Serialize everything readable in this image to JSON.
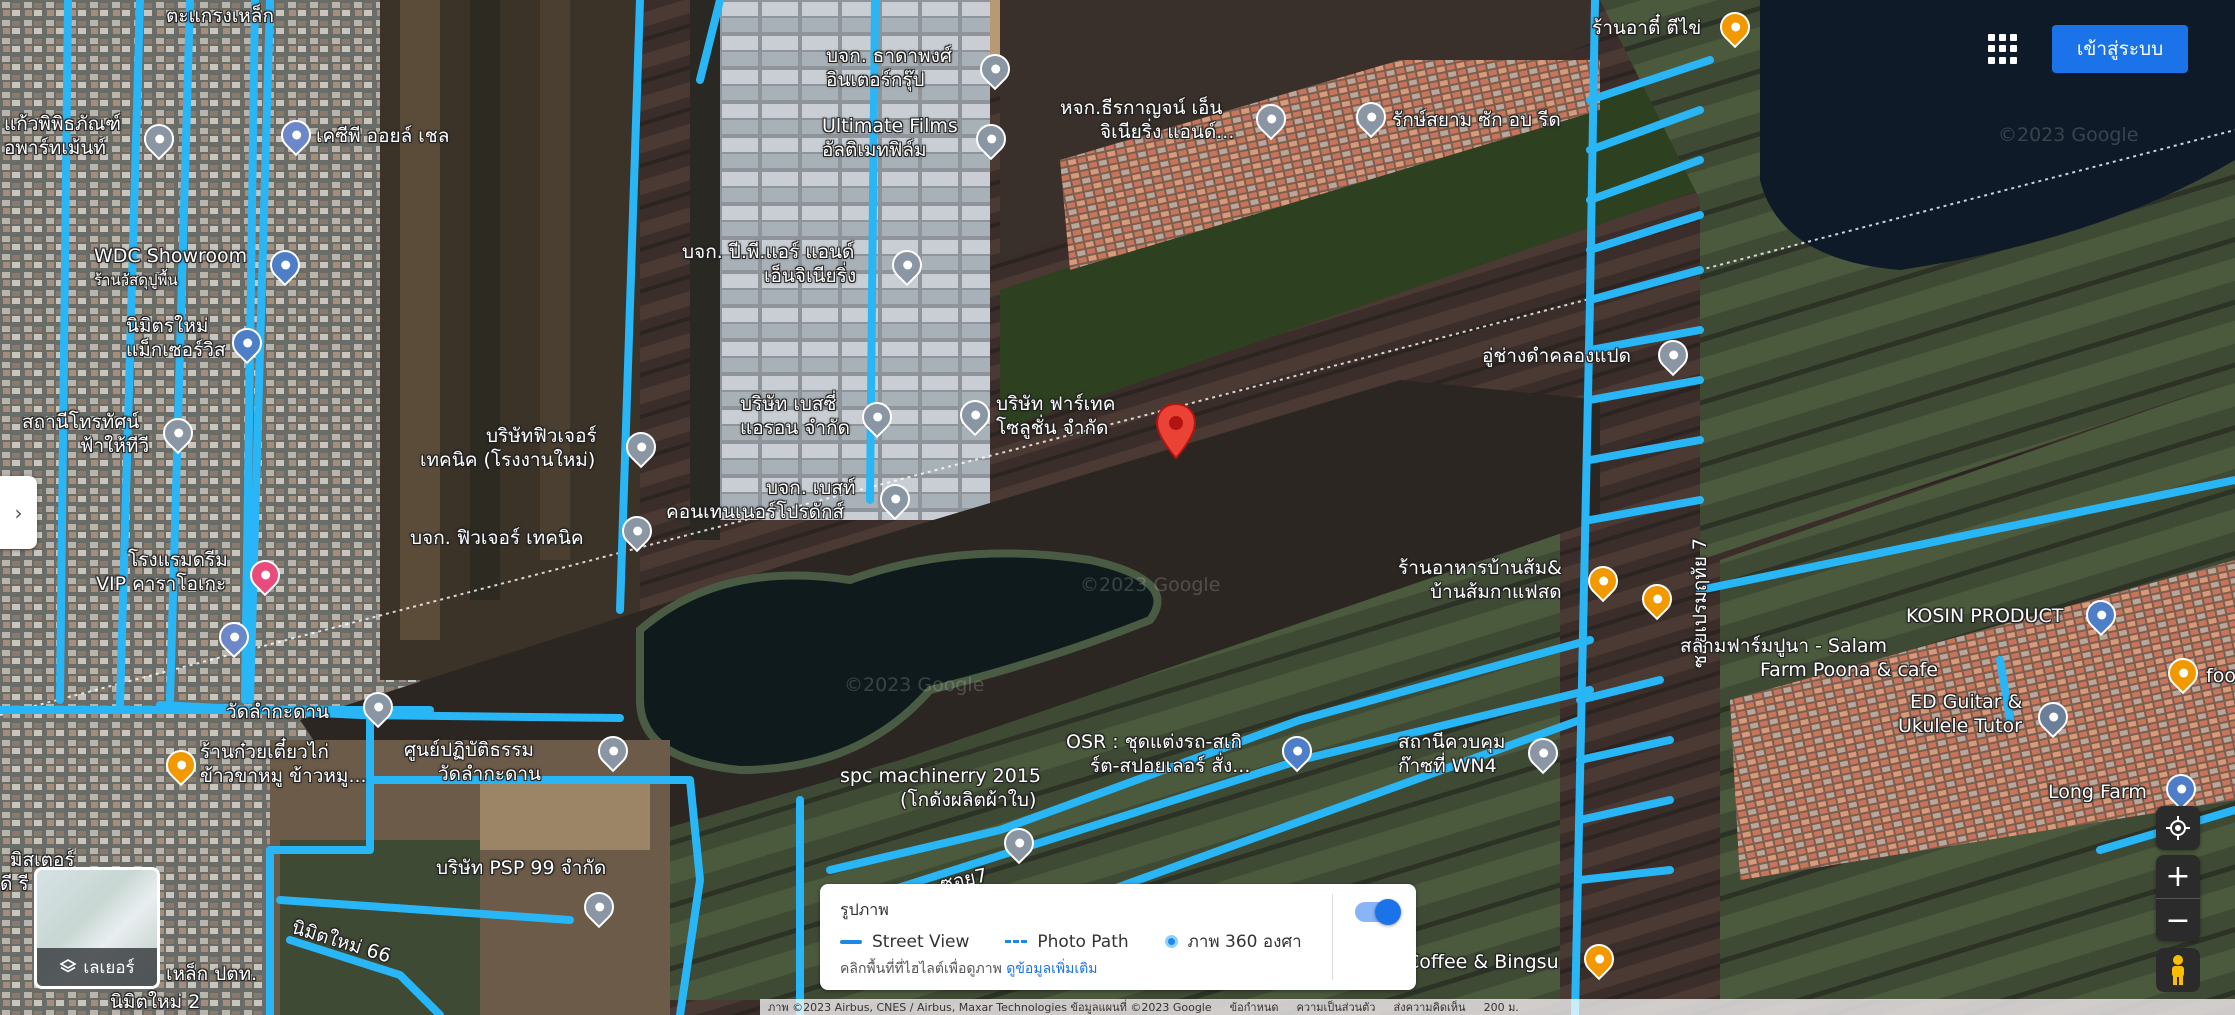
{
  "colors": {
    "road_blue": "#29b6f6",
    "accent_blue": "#1a73e8",
    "marker_red": "#ea4335"
  },
  "header": {
    "apps_icon": "apps-grid-icon",
    "signin_label": "เข้าสู่ระบบ"
  },
  "places": [
    {
      "name": "ตะแกรงเหล็ก",
      "lines": [
        "ตะแกรงเหล็ก"
      ],
      "kind": "gray"
    },
    {
      "name": "แก้วพิพิธภัณฑ์ อพาร์ทเม้นท์",
      "lines": [
        "แก้วพิพิธภัณฑ์",
        "อพาร์ทเม้นท์"
      ],
      "kind": "gray"
    },
    {
      "name": "เคซีพี ออยล์ เชล",
      "lines": [
        "เคซีพี ออยล์ เชล"
      ],
      "kind": "fuel"
    },
    {
      "name": "WDC Showroom",
      "lines": [
        "WDC Showroom",
        "ร้านวัสดุปูพื้น"
      ],
      "kind": "shop"
    },
    {
      "name": "นิมิตรใหม่ แม็กเซอร์วิส",
      "lines": [
        "นิมิตรใหม่",
        "แม็กเซอร์วิส"
      ],
      "kind": "shop"
    },
    {
      "name": "สถานีโทรทัศน์ ฟ้าให้ทีวี",
      "lines": [
        "สถานีโทรทัศน์",
        "ฟ้าให้ทีวี"
      ],
      "kind": "gray"
    },
    {
      "name": "โรงแรมดรีม VIP คาราโอเกะ",
      "lines": [
        "โรงแรมดรีม",
        "VIP คาราโอเกะ"
      ],
      "kind": "red"
    },
    {
      "name": "วัดลำกะดาน",
      "lines": [
        "วัดลำกะดาน"
      ],
      "kind": "gray"
    },
    {
      "name": "ร้านก๋วยเตี๋ยวไก่ ข้าวขาหมู ข้าวหมู...",
      "lines": [
        "ร้านก๋วยเตี๋ยวไก่",
        "ข้าวขาหมู ข้าวหมู..."
      ],
      "kind": "food"
    },
    {
      "name": "มิสเตอร์",
      "lines": [
        "มิสเตอร์"
      ],
      "kind": "shop"
    },
    {
      "name": "บจก. ธาดาพงศ์ อินเตอร์กรุ๊ป",
      "lines": [
        "บจก. ธาดาพงศ์",
        "อินเตอร์กรุ๊ป"
      ],
      "kind": "gray"
    },
    {
      "name": "Ultimate Films อัลติเมทฟิล์ม",
      "lines": [
        "Ultimate Films",
        "อัลติเมทฟิล์ม"
      ],
      "kind": "gray"
    },
    {
      "name": "บจก. ปี.พี.แอร์ แอนด์ เอ็นจิเนียริ่ง",
      "lines": [
        "บจก. ปี.พี.แอร์ แอนด์",
        "เอ็นจิเนียริ่ง"
      ],
      "kind": "gray"
    },
    {
      "name": "บริษัท เบสซี่ แอรอน จำกัด",
      "lines": [
        "บริษัท เบสซี่",
        "แอรอน จำกัด"
      ],
      "kind": "gray"
    },
    {
      "name": "บริษัท ฟาร์เทค โซลูชั่น จำกัด",
      "lines": [
        "บริษัท ฟาร์เทค",
        "โซลูชั่น จำกัด"
      ],
      "kind": "gray"
    },
    {
      "name": "บริษัทฟิวเจอร์ เทคนิค (โรงงานใหม่)",
      "lines": [
        "บริษัทฟิวเจอร์",
        "เทคนิค (โรงงานใหม่)"
      ],
      "kind": "gray"
    },
    {
      "name": "บจก. เบสท์ คอนเทนเนอร์โปรดักส์",
      "lines": [
        "บจก. เบสท์",
        "คอนเทนเนอร์โปรดักส์"
      ],
      "kind": "gray"
    },
    {
      "name": "บจก. ฟิวเจอร์ เทคนิค",
      "lines": [
        "บจก. ฟิวเจอร์ เทคนิค"
      ],
      "kind": "gray"
    },
    {
      "name": "ศูนย์ปฏิบัติธรรม วัดลำกะดาน",
      "lines": [
        "ศูนย์ปฏิบัติธรรม",
        "วัดลำกะดาน"
      ],
      "kind": "gray"
    },
    {
      "name": "บริษัท PSP 99 จำกัด",
      "lines": [
        "บริษัท PSP 99 จำกัด"
      ],
      "kind": "gray"
    },
    {
      "name": "spc machinerry 2015 (โกดังผลิตผ้าใบ)",
      "lines": [
        "spc machinerry 2015",
        "(โกดังผลิตผ้าใบ)"
      ],
      "kind": "gray"
    },
    {
      "name": "OSR : ชุดแต่งรถ-สเกิร์ต-สปอยเลอร์ สั่ง...",
      "lines": [
        "OSR : ชุดแต่งรถ-สเกิ",
        "ร์ต-สปอยเลอร์ สั่ง..."
      ],
      "kind": "shop"
    },
    {
      "name": "หจก.ธีรกาญจน์ เอ็น จิเนียริ่ง แอนด์...",
      "lines": [
        "หจก.ธีรกาญจน์ เอ็น",
        "จิเนียริ่ง แอนด์..."
      ],
      "kind": "gray"
    },
    {
      "name": "รักษ์สยาม ซัก อบ รีด",
      "lines": [
        "รักษ์สยาม ซัก อบ รีด"
      ],
      "kind": "gray"
    },
    {
      "name": "ร้านอาตี๋ ตีไข่",
      "lines": [
        "ร้านอาตี๋ ตีไข่"
      ],
      "kind": "food"
    },
    {
      "name": "อู่ช่างดำคลองแปด",
      "lines": [
        "อู่ช่างดำคลองแปด"
      ],
      "kind": "gray"
    },
    {
      "name": "ร้านอาหารบ้านส้ม& บ้านส้มกาแฟสด",
      "lines": [
        "ร้านอาหารบ้านส้ม&",
        "บ้านส้มกาแฟสด"
      ],
      "kind": "food"
    },
    {
      "name": "สถานีควบคุม ก๊าซที่ WN4",
      "lines": [
        "สถานีควบคุม",
        "ก๊าซที่ WN4"
      ],
      "kind": "gray"
    },
    {
      "name": "สลามฟาร์มปูนา - Salam Farm Poona & cafe",
      "lines": [
        "สลามฟาร์มปูนา - Salam",
        "Farm Poona & cafe"
      ],
      "kind": "food"
    },
    {
      "name": "KOSIN PRODUCT",
      "lines": [
        "KOSIN PRODUCT"
      ],
      "kind": "shop"
    },
    {
      "name": "ED Guitar & Ukulele Tutor",
      "lines": [
        "ED Guitar &",
        "Ukulele Tutor"
      ],
      "kind": "edu"
    },
    {
      "name": "Long Farm",
      "lines": [
        "Long Farm"
      ],
      "kind": "shop"
    },
    {
      "name": "foo",
      "lines": [
        "foo"
      ],
      "kind": "food"
    },
    {
      "name": "Coffee & Bingsu",
      "lines": [
        "Coffee & Bingsu"
      ],
      "kind": "food"
    },
    {
      "name": "เหล็ก ปตท.",
      "lines": [
        "เหล็ก ปตท."
      ],
      "kind": "gray"
    }
  ],
  "road_labels": {
    "soi_khlong8": "ซอยเปรมฤทัย 7",
    "nimit_66": "นิมิตใหม่ 66",
    "nimit_2": "นิมิตใหม่ 2",
    "soi_7": "ซอย7",
    "left_cut": "ดี รี"
  },
  "sidebar": {
    "collapse_icon": "chevron-right-icon"
  },
  "layers": {
    "label": "เลเยอร์",
    "icon": "layers-icon"
  },
  "legend": {
    "title": "รูปภาพ",
    "street_view": "Street View",
    "photo_path": "Photo Path",
    "photo_360": "ภาพ 360 องศา",
    "hint": "คลิกพื้นที่ที่ไฮไลต์เพื่อดูภาพ",
    "more_info": "ดูข้อมูลเพิ่มเติม"
  },
  "controls": {
    "zoom_in": "+",
    "zoom_out": "−",
    "locate_icon": "my-location-icon",
    "pegman_icon": "pegman-icon"
  },
  "footer": {
    "attribution": "ภาพ ©2023 Airbus, CNES / Airbus, Maxar Technologies ข้อมูลแผนที่ ©2023 Google",
    "terms": "ข้อกำหนด",
    "privacy": "ความเป็นส่วนตัว",
    "feedback": "ส่งความคิดเห็น",
    "scale": "200 ม."
  },
  "watermarks": {
    "copyright": "©2023 Google"
  }
}
